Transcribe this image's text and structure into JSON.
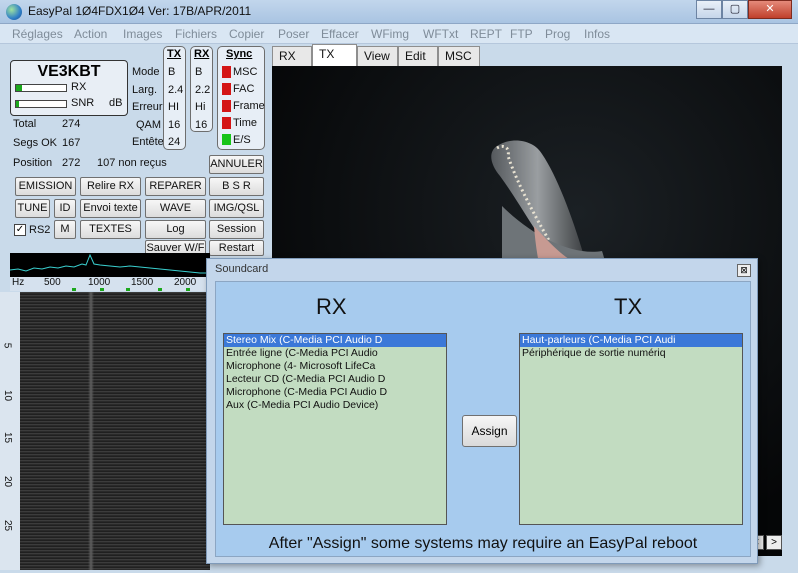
{
  "window": {
    "title": "EasyPal  1Ø4FDX1Ø4   Ver: 17B/APR/2011",
    "min": "—",
    "max": "▢",
    "close": "✕"
  },
  "menu": [
    "Réglages",
    "Action",
    "Images",
    "Fichiers",
    "Copier",
    "Poser",
    "Effacer",
    "WFimg",
    "WFTxt",
    "REPT",
    "FTP",
    "Prog",
    "Infos"
  ],
  "callsign": "VE3KBT",
  "meters": {
    "rx_label": "RX",
    "snr_label": "SNR",
    "snr_unit": "dB",
    "rx_level": 0.12,
    "snr_level": 0.05
  },
  "stats": {
    "total_label": "Total",
    "total": "274",
    "segs_label": "Segs OK",
    "segs": "167",
    "position_label": "Position",
    "position": "272",
    "non_recus": "107 non reçus"
  },
  "params": {
    "labels": [
      "Mode",
      "Larg.",
      "Erreur",
      "QAM",
      "Entête"
    ],
    "tx_header": "TX",
    "rx_header": "RX",
    "tx": [
      "B",
      "2.4",
      "HI",
      "16",
      "24"
    ],
    "rx": [
      "B",
      "2.2",
      "Hi",
      "16"
    ]
  },
  "sync": {
    "header": "Sync",
    "items": [
      "MSC",
      "FAC",
      "Frame",
      "Time",
      "E/S"
    ]
  },
  "buttons": {
    "annuler": "ANNULER",
    "emission": "EMISSION",
    "relire": "Relire RX",
    "reparer": "REPARER",
    "bsr": "B S R",
    "tune": "TUNE",
    "id": "ID",
    "envoi": "Envoi texte",
    "wave": "WAVE",
    "imgqsl": "IMG/QSL",
    "rs2": "RS2",
    "m": "M",
    "textes": "TEXTES",
    "log": "Log",
    "session": "Session",
    "sauver": "Sauver W/F",
    "restart": "Restart"
  },
  "freq_axis": {
    "unit": "Hz",
    "ticks": [
      "500",
      "1000",
      "1500",
      "2000"
    ]
  },
  "time_axis": [
    "5",
    "10",
    "15",
    "20",
    "25"
  ],
  "tabs": [
    "RX",
    "TX",
    "View",
    "Edit",
    "MSC"
  ],
  "active_tab": "TX",
  "dialog": {
    "title": "Soundcard",
    "rx_title": "RX",
    "tx_title": "TX",
    "rx_devices": [
      "Stereo Mix (C-Media PCI Audio D",
      "Entrée ligne (C-Media PCI Audio",
      "Microphone (4- Microsoft LifeCa",
      "Lecteur CD (C-Media PCI Audio D",
      "Microphone (C-Media PCI Audio D",
      "Aux (C-Media PCI Audio Device)"
    ],
    "tx_devices": [
      "Haut-parleurs (C-Media PCI Audi",
      "Périphérique de sortie numériq"
    ],
    "assign": "Assign",
    "note": "After \"Assign\" some systems may require an EasyPal reboot"
  },
  "scroll": {
    "left": "<",
    "right": ">"
  }
}
